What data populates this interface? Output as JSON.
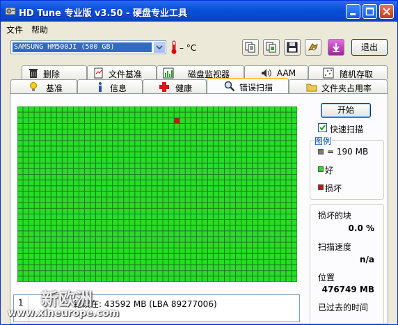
{
  "window": {
    "title": "HD Tune 专业版 v3.50 - 硬盘专业工具"
  },
  "menu": {
    "items": [
      "文件",
      "帮助"
    ]
  },
  "toolbar": {
    "drive": "SAMSUNG HM500JI (500 GB)",
    "temperature": "– °C",
    "exit_label": "退出",
    "buttons": [
      "copy-text-icon",
      "copy-screenshot-icon",
      "save-icon",
      "options-icon",
      "down-arrow-icon"
    ]
  },
  "tabs": {
    "row1": [
      "删除",
      "文件基准",
      "磁盘监视器",
      "AAM",
      "随机存取"
    ],
    "row2": [
      "基准",
      "信息",
      "健康",
      "错误扫描",
      "文件夹占用率"
    ],
    "active": "错误扫描"
  },
  "scan": {
    "start_label": "开始",
    "quick_scan_label": "快速扫描",
    "quick_scan_checked": true,
    "legend_title": "图例",
    "legend_block": "= 190 MB",
    "legend_good": "好",
    "legend_bad": "损坏",
    "damaged_label": "损坏的块",
    "damaged_value": "0.0 %",
    "speed_label": "扫描速度",
    "speed_value": "n/a",
    "position_label": "位置",
    "position_value": "476749 MB",
    "elapsed_label": "已过去的时间",
    "grid_cols": 50,
    "grid_rows": 31,
    "bad_blocks": [
      [
        28,
        2
      ]
    ],
    "colors": {
      "good": "#28dc28",
      "bad": "#c81414",
      "grid": "#1a7a1a",
      "unscanned": "#7a7a7a"
    }
  },
  "error_log": {
    "rows": [
      {
        "num": "1",
        "text": "错误在: 43592 MB (LBA 89277006)"
      }
    ]
  },
  "watermark": {
    "site": "新欧洲",
    "url": "www.xineurope.com"
  }
}
